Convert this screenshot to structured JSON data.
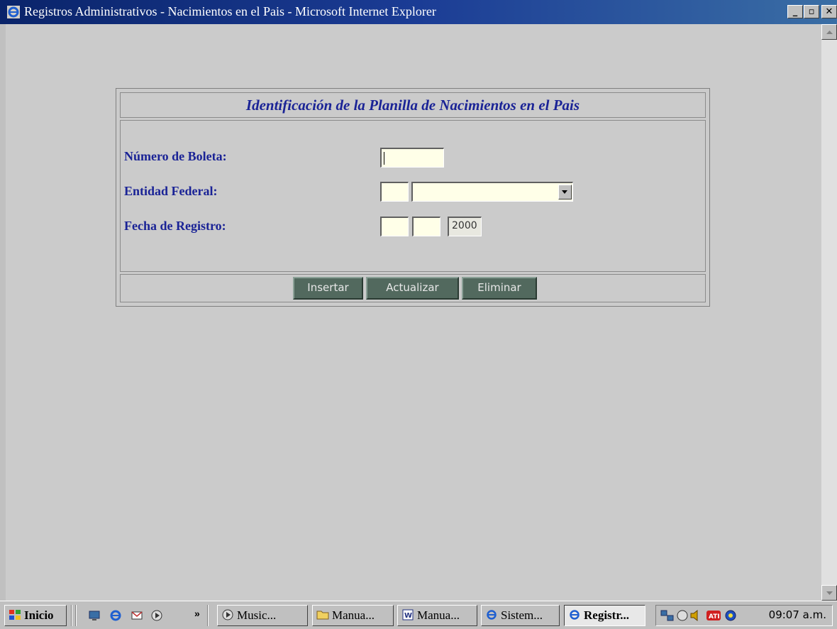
{
  "window": {
    "title": "Registros Administrativos - Nacimientos en el Pais - Microsoft Internet Explorer",
    "minimize": "_",
    "maximize": "▫",
    "close": "✕"
  },
  "form": {
    "title": "Identificación de la Planilla de Nacimientos en el Pais",
    "fields": {
      "numero_boleta": {
        "label": "Número de Boleta:",
        "value": ""
      },
      "entidad_federal": {
        "label": "Entidad Federal:",
        "code": "",
        "selected": ""
      },
      "fecha_registro": {
        "label": "Fecha de Registro:",
        "day": "",
        "month": "",
        "year": "2000"
      }
    },
    "buttons": {
      "insertar": "Insertar",
      "actualizar": "Actualizar",
      "eliminar": "Eliminar"
    }
  },
  "taskbar": {
    "start_label": "Inicio",
    "overflow": "»",
    "tasks": [
      {
        "label": "Music...",
        "icon": "media-icon"
      },
      {
        "label": "Manua...",
        "icon": "folder-icon"
      },
      {
        "label": "Manua...",
        "icon": "word-icon"
      },
      {
        "label": "Sistem...",
        "icon": "ie-icon"
      },
      {
        "label": "Registr...",
        "icon": "ie-icon",
        "active": true
      }
    ],
    "clock": "09:07 a.m."
  },
  "colors": {
    "title_bar": "#0a246a",
    "form_text": "#1a2396",
    "button_bg": "#52695e",
    "input_bg": "#ffffe8"
  }
}
